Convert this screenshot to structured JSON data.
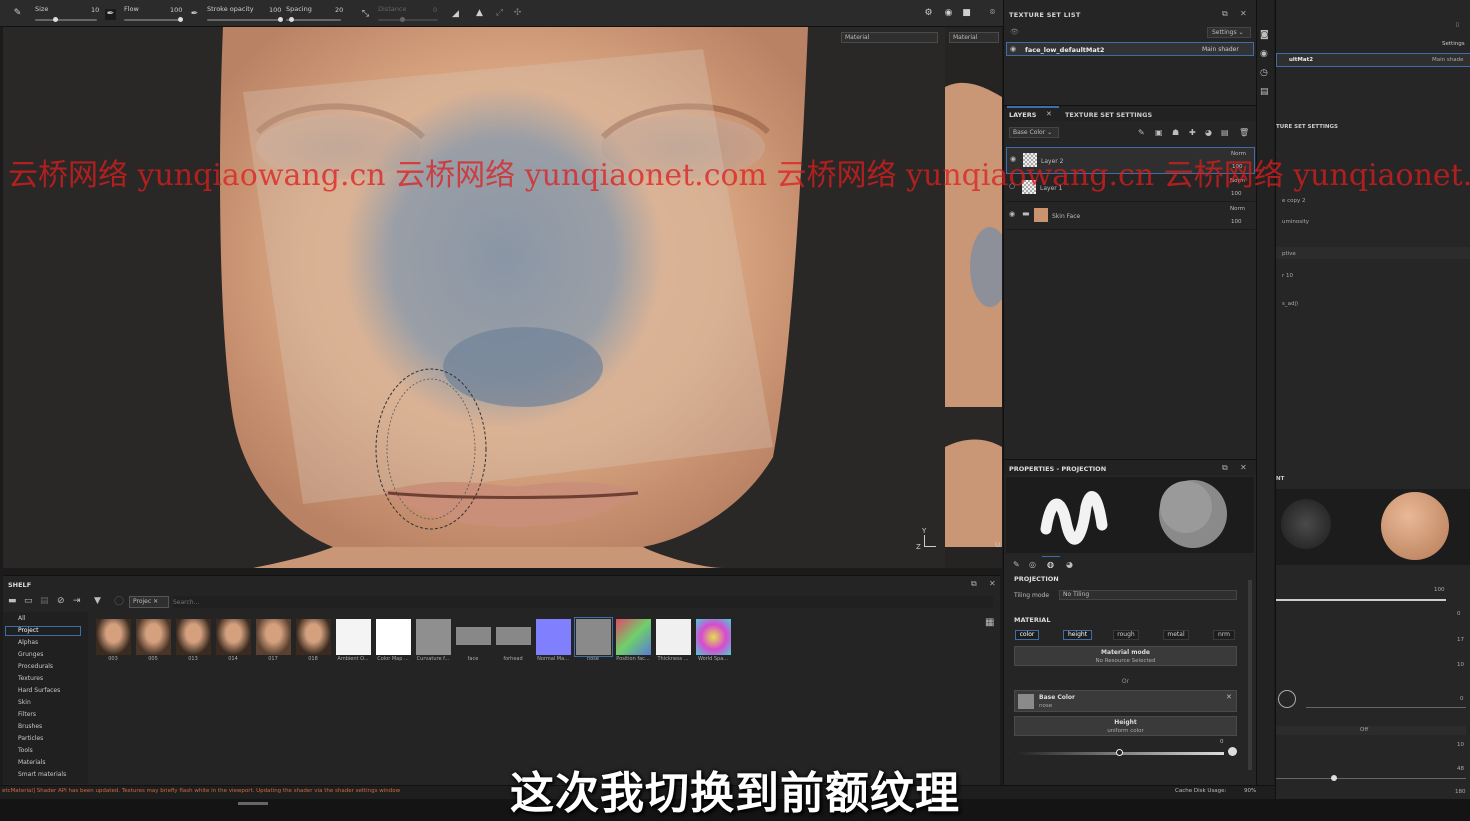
{
  "toolbar": {
    "size_label": "Size",
    "size_value": "10",
    "flow_label": "Flow",
    "flow_value": "100",
    "stroke_opacity_label": "Stroke opacity",
    "stroke_opacity_value": "100",
    "spacing_label": "Spacing",
    "spacing_value": "20",
    "distance_label": "Distance",
    "distance_value": "0",
    "progress": {
      "size": 0.35,
      "flow": 1.0,
      "stroke_opacity": 1.0,
      "spacing": 0.2
    }
  },
  "viewport": {
    "material_select": "Material",
    "side_material_select": "Material",
    "axis_y": "Y",
    "axis_z": "Z",
    "axis_u": "U"
  },
  "texture_set_list": {
    "title": "TEXTURE SET LIST",
    "settings": "Settings",
    "set_name": "face_low_defaultMat2",
    "shader": "Main shader"
  },
  "layers": {
    "tab_layers": "LAYERS",
    "tab_settings": "TEXTURE SET SETTINGS",
    "channel": "Base Color",
    "items": [
      {
        "name": "Layer 2",
        "blend": "Norm",
        "opacity": "100"
      },
      {
        "name": "Layer 1",
        "blend": "Norm",
        "opacity": "100"
      },
      {
        "name": "Skin Face",
        "blend": "Norm",
        "opacity": "100"
      }
    ]
  },
  "properties": {
    "title": "PROPERTIES - PROJECTION",
    "projection_label": "PROJECTION",
    "tiling_label": "Tiling mode",
    "tiling_value": "No Tiling",
    "material_label": "MATERIAL",
    "channels": [
      "color",
      "height",
      "rough",
      "metal",
      "nrm"
    ],
    "material_mode_title": "Material mode",
    "material_mode_value": "No Resource Selected",
    "or": "Or",
    "base_color_title": "Base Color",
    "base_color_value": "nose",
    "height_title": "Height",
    "height_value": "uniform color",
    "height_slider_value": "0",
    "height_slider_position": 0.5
  },
  "shelf": {
    "title": "SHELF",
    "filter_tag": "Projec",
    "search_placeholder": "Search...",
    "categories": [
      "All",
      "Project",
      "Alphas",
      "Grunges",
      "Procedurals",
      "Textures",
      "Hard Surfaces",
      "Skin",
      "Filters",
      "Brushes",
      "Particles",
      "Tools",
      "Materials",
      "Smart materials"
    ],
    "selected_category": "Project",
    "items": [
      "003",
      "005",
      "013",
      "014",
      "017",
      "018",
      "Ambient O...",
      "Color Map ...",
      "Curvature f...",
      "face",
      "forhead",
      "Normal Ma...",
      "nose",
      "Position fac...",
      "Thickness ...",
      "World Spa..."
    ]
  },
  "status": {
    "message": "etcMaterial] Shader API has been updated. Textures may briefly flash white in the viewport. Updating the shader via the shader settings window",
    "cache": "Cache Disk Usage:",
    "cache_value": "90%"
  },
  "ghost_panel": {
    "settings": "Settings",
    "set_name": "ultMat2",
    "shader": "Main shade",
    "tab_settings": "TURE SET SETTINGS",
    "rows": [
      "e copy 2",
      "uminosity",
      "ptive",
      "r 10",
      "s_adj)"
    ],
    "section": "NT",
    "numbers": [
      "100",
      "0",
      "17",
      "10",
      "0",
      "10",
      "48",
      "180"
    ],
    "off": "Off"
  },
  "watermark": "云桥网络 yunqiaowang.cn 云桥网络 yunqiaonet.com 云桥网络 yunqiaowang.cn 云桥网络 yunqiaonet.com",
  "subtitle": "这次我切换到前额纹理"
}
